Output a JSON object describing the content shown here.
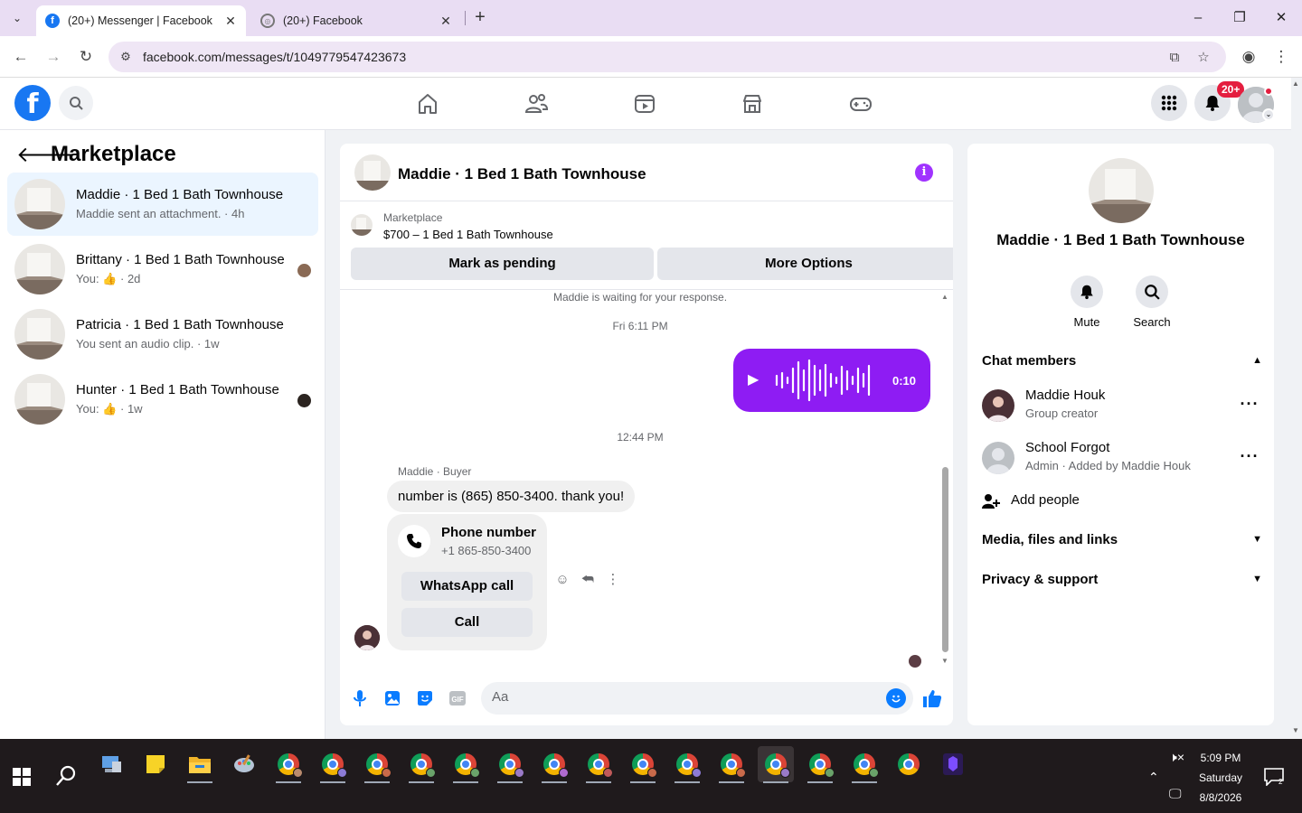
{
  "browser": {
    "tabs": [
      {
        "title": "(20+) Messenger | Facebook",
        "active": true
      },
      {
        "title": "(20+) Facebook",
        "active": false
      }
    ],
    "url": "facebook.com/messages/t/1049779547423673",
    "window_controls": {
      "minimize": "–",
      "maximize": "❐",
      "close": "✕"
    }
  },
  "fb_header": {
    "logo": "f",
    "nav_icons": [
      "home-icon",
      "friends-icon",
      "video-icon",
      "marketplace-icon",
      "gaming-icon"
    ],
    "notification_badge": "20+"
  },
  "left_panel": {
    "title": "Marketplace",
    "conversations": [
      {
        "name": "Maddie · 1 Bed 1 Bath Townhouse",
        "subtitle": "Maddie sent an attachment. · 4h",
        "active": true
      },
      {
        "name": "Brittany · 1 Bed 1 Bath Townhouse",
        "subtitle_prefix": "You:",
        "subtitle_suffix": "· 2d",
        "active": false
      },
      {
        "name": "Patricia · 1 Bed 1 Bath Townhouse",
        "subtitle": "You sent an audio clip. · 1w",
        "active": false
      },
      {
        "name": "Hunter · 1 Bed 1 Bath Townhouse",
        "subtitle_prefix": "You:",
        "subtitle_suffix": "· 1w",
        "active": false
      }
    ]
  },
  "chat": {
    "title": "Maddie · 1 Bed 1 Bath Townhouse",
    "listing": {
      "source": "Marketplace",
      "title": "$700 – 1 Bed 1 Bath Townhouse",
      "mark_pending_label": "Mark as pending",
      "more_options_label": "More Options"
    },
    "waiting_text": "Maddie is waiting for your response.",
    "timestamp_1": "Fri 6:11 PM",
    "audio_duration": "0:10",
    "timestamp_2": "12:44 PM",
    "sender_label": "Maddie · Buyer",
    "message_text": "number is (865) 850-3400. thank you!",
    "phone_card": {
      "title": "Phone number",
      "number": "+1 865-850-3400",
      "whatsapp_label": "WhatsApp call",
      "call_label": "Call"
    },
    "composer_placeholder": "Aa"
  },
  "right_panel": {
    "name": "Maddie · 1 Bed 1 Bath Townhouse",
    "actions": [
      {
        "label": "Mute",
        "icon": "bell-icon"
      },
      {
        "label": "Search",
        "icon": "search-icon"
      }
    ],
    "chat_members_label": "Chat members",
    "members": [
      {
        "name": "Maddie Houk",
        "role": "Group creator"
      },
      {
        "name": "School Forgot",
        "role": "Admin · Added by Maddie Houk"
      }
    ],
    "add_people_label": "Add people",
    "media_label": "Media, files and links",
    "privacy_label": "Privacy & support"
  },
  "taskbar": {
    "time": "5:09 PM",
    "day": "Saturday",
    "date": "8/8/2026"
  },
  "colors": {
    "fb_blue": "#1877f2",
    "messenger_purple": "#8e1cf3",
    "badge_red": "#e41e3f",
    "tab_strip": "#e9ddf3"
  }
}
